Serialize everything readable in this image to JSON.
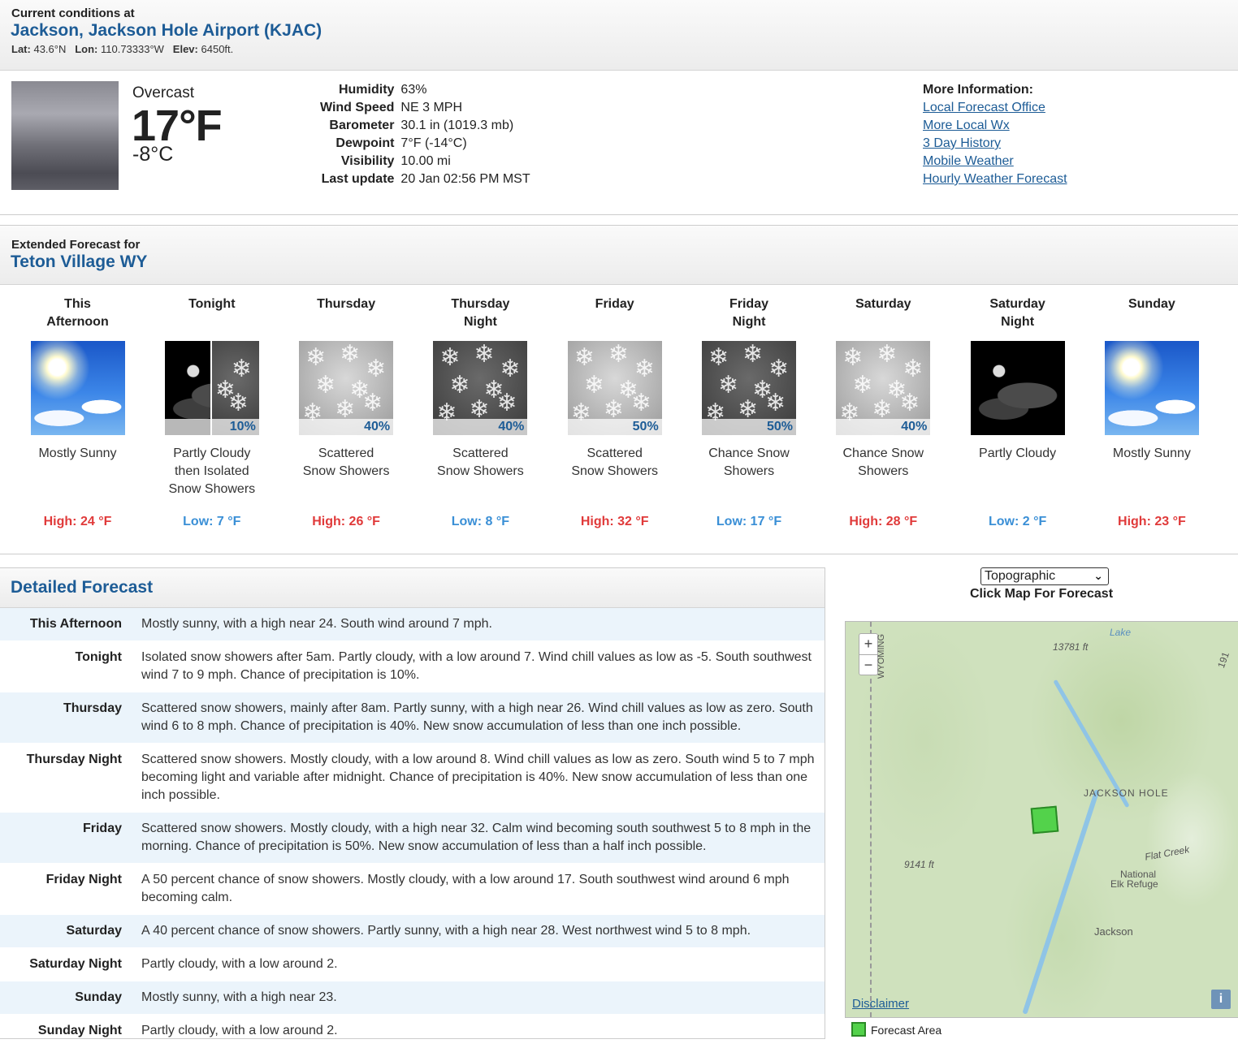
{
  "current": {
    "label": "Current conditions at",
    "station": "Jackson, Jackson Hole Airport (KJAC)",
    "lat_label": "Lat:",
    "lat": "43.6°N",
    "lon_label": "Lon:",
    "lon": "110.73333°W",
    "elev_label": "Elev:",
    "elev": "6450ft.",
    "condition": "Overcast",
    "temp_f": "17°F",
    "temp_c": "-8°C",
    "details": [
      {
        "k": "Humidity",
        "v": "63%"
      },
      {
        "k": "Wind Speed",
        "v": "NE 3 MPH"
      },
      {
        "k": "Barometer",
        "v": "30.1 in (1019.3 mb)"
      },
      {
        "k": "Dewpoint",
        "v": "7°F (-14°C)"
      },
      {
        "k": "Visibility",
        "v": "10.00 mi"
      },
      {
        "k": "Last update",
        "v": "20 Jan 02:56 PM MST"
      }
    ],
    "more_title": "More Information:",
    "more_links": [
      "Local Forecast Office",
      "More Local Wx",
      "3 Day History",
      "Mobile Weather",
      "Hourly Weather Forecast"
    ]
  },
  "extended": {
    "label": "Extended Forecast for",
    "place": "Teton Village WY",
    "periods": [
      {
        "name": [
          "This",
          "Afternoon"
        ],
        "icon": "sunny-icon",
        "pct": "",
        "desc": [
          "Mostly Sunny"
        ],
        "temp": "High: 24 °F",
        "kind": "hi"
      },
      {
        "name": [
          "Tonight"
        ],
        "icon": "night-partly-cloudy-snow-icon",
        "pct": "10%",
        "desc": [
          "Partly Cloudy",
          "then Isolated",
          "Snow Showers"
        ],
        "temp": "Low: 7 °F",
        "kind": "lo"
      },
      {
        "name": [
          "Thursday"
        ],
        "icon": "snow-showers-icon",
        "pct": "40%",
        "desc": [
          "Scattered",
          "Snow Showers"
        ],
        "temp": "High: 26 °F",
        "kind": "hi"
      },
      {
        "name": [
          "Thursday",
          "Night"
        ],
        "icon": "night-snow-showers-icon",
        "pct": "40%",
        "desc": [
          "Scattered",
          "Snow Showers"
        ],
        "temp": "Low: 8 °F",
        "kind": "lo"
      },
      {
        "name": [
          "Friday"
        ],
        "icon": "snow-showers-icon",
        "pct": "50%",
        "desc": [
          "Scattered",
          "Snow Showers"
        ],
        "temp": "High: 32 °F",
        "kind": "hi"
      },
      {
        "name": [
          "Friday",
          "Night"
        ],
        "icon": "night-snow-showers-icon",
        "pct": "50%",
        "desc": [
          "Chance Snow",
          "Showers"
        ],
        "temp": "Low: 17 °F",
        "kind": "lo"
      },
      {
        "name": [
          "Saturday"
        ],
        "icon": "snow-showers-icon",
        "pct": "40%",
        "desc": [
          "Chance Snow",
          "Showers"
        ],
        "temp": "High: 28 °F",
        "kind": "hi"
      },
      {
        "name": [
          "Saturday",
          "Night"
        ],
        "icon": "night-partly-cloudy-icon",
        "pct": "",
        "desc": [
          "Partly Cloudy"
        ],
        "temp": "Low: 2 °F",
        "kind": "lo"
      },
      {
        "name": [
          "Sunday"
        ],
        "icon": "sunny-icon",
        "pct": "",
        "desc": [
          "Mostly Sunny"
        ],
        "temp": "High: 23 °F",
        "kind": "hi"
      }
    ]
  },
  "detailed": {
    "title": "Detailed Forecast",
    "rows": [
      {
        "label": "This Afternoon",
        "text": "Mostly sunny, with a high near 24. South wind around 7 mph."
      },
      {
        "label": "Tonight",
        "text": "Isolated snow showers after 5am. Partly cloudy, with a low around 7. Wind chill values as low as -5. South southwest wind 7 to 9 mph. Chance of precipitation is 10%."
      },
      {
        "label": "Thursday",
        "text": "Scattered snow showers, mainly after 8am. Partly sunny, with a high near 26. Wind chill values as low as zero. South wind 6 to 8 mph. Chance of precipitation is 40%. New snow accumulation of less than one inch possible."
      },
      {
        "label": "Thursday Night",
        "text": "Scattered snow showers. Mostly cloudy, with a low around 8. Wind chill values as low as zero. South wind 5 to 7 mph becoming light and variable after midnight. Chance of precipitation is 40%. New snow accumulation of less than one inch possible."
      },
      {
        "label": "Friday",
        "text": "Scattered snow showers. Mostly cloudy, with a high near 32. Calm wind becoming south southwest 5 to 8 mph in the morning. Chance of precipitation is 50%. New snow accumulation of less than a half inch possible."
      },
      {
        "label": "Friday Night",
        "text": "A 50 percent chance of snow showers. Mostly cloudy, with a low around 17. South southwest wind around 6 mph becoming calm."
      },
      {
        "label": "Saturday",
        "text": "A 40 percent chance of snow showers. Partly sunny, with a high near 28. West northwest wind 5 to 8 mph."
      },
      {
        "label": "Saturday Night",
        "text": "Partly cloudy, with a low around 2."
      },
      {
        "label": "Sunday",
        "text": "Mostly sunny, with a high near 23."
      },
      {
        "label": "Sunday Night",
        "text": "Partly cloudy, with a low around 2."
      }
    ]
  },
  "map": {
    "select_value": "Topographic",
    "click_label": "Click Map For Forecast",
    "zoom_in": "+",
    "zoom_out": "−",
    "labels": {
      "jackson_hole": "JACKSON HOLE",
      "jackson": "Jackson",
      "refuge1": "National",
      "refuge2": "Elk Refuge",
      "flat_creek": "Flat Creek",
      "peak1": "13781 ft",
      "peak2": "9141 ft",
      "wyoming": "WYOMING",
      "lake": "Lake",
      "route": "191"
    },
    "disclaimer": "Disclaimer",
    "info": "i",
    "legend": "Forecast Area"
  }
}
